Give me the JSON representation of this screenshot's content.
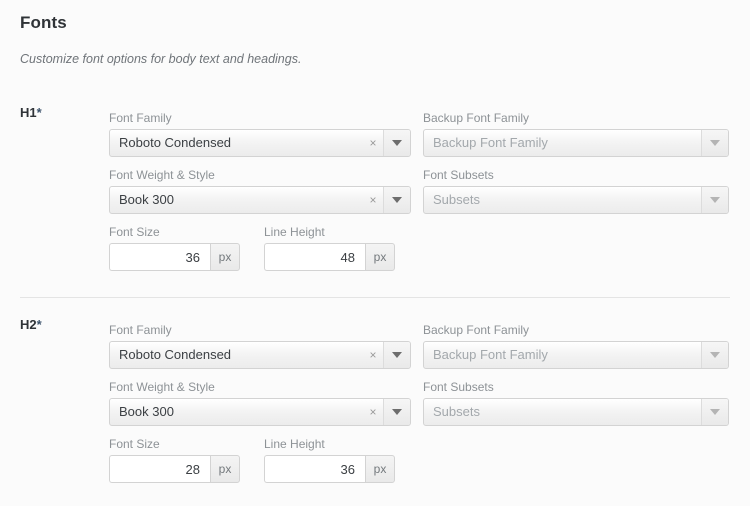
{
  "header": {
    "title": "Fonts",
    "subtitle": "Customize font options for body text and headings."
  },
  "icons": {
    "clear": "×",
    "caret": "chevron-down-icon"
  },
  "units": {
    "px": "px"
  },
  "sections": [
    {
      "label": "H1",
      "required_marker": "*",
      "fields": {
        "font_family": {
          "label": "Font Family",
          "value": "Roboto Condensed",
          "clearable": true
        },
        "backup_font_family": {
          "label": "Backup Font Family",
          "value": "Backup Font Family",
          "is_placeholder": true,
          "clearable": false
        },
        "font_weight_style": {
          "label": "Font Weight & Style",
          "value": "Book 300",
          "clearable": true
        },
        "font_subsets": {
          "label": "Font Subsets",
          "value": "Subsets",
          "is_placeholder": true,
          "clearable": false
        },
        "font_size": {
          "label": "Font Size",
          "value": "36",
          "unit": "px"
        },
        "line_height": {
          "label": "Line Height",
          "value": "48",
          "unit": "px"
        }
      }
    },
    {
      "label": "H2",
      "required_marker": "*",
      "fields": {
        "font_family": {
          "label": "Font Family",
          "value": "Roboto Condensed",
          "clearable": true
        },
        "backup_font_family": {
          "label": "Backup Font Family",
          "value": "Backup Font Family",
          "is_placeholder": true,
          "clearable": false
        },
        "font_weight_style": {
          "label": "Font Weight & Style",
          "value": "Book 300",
          "clearable": true
        },
        "font_subsets": {
          "label": "Font Subsets",
          "value": "Subsets",
          "is_placeholder": true,
          "clearable": false
        },
        "font_size": {
          "label": "Font Size",
          "value": "28",
          "unit": "px"
        },
        "line_height": {
          "label": "Line Height",
          "value": "36",
          "unit": "px"
        }
      }
    }
  ],
  "colors": {
    "background": "#fbfbfb",
    "title": "#2f3337",
    "label": "#8d9296",
    "value": "#3c4044",
    "border": "#d3d3d3",
    "divider": "#e4e4e4"
  }
}
